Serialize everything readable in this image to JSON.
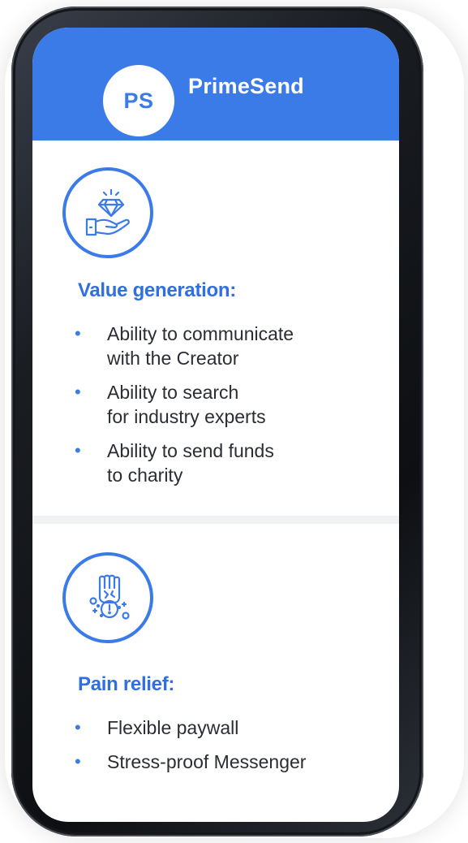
{
  "brand": {
    "initials": "PS",
    "name": "PrimeSend"
  },
  "colors": {
    "accent": "#3b7be8",
    "text": "#2a2d34"
  },
  "sections": [
    {
      "icon": "diamond-in-hand-icon",
      "title": "Value generation:",
      "items": [
        [
          "Ability to communicate",
          "with the Creator"
        ],
        [
          "Ability to search",
          "for industry experts"
        ],
        [
          "Ability to send funds",
          "to charity"
        ]
      ]
    },
    {
      "icon": "fist-with-badge-icon",
      "title": "Pain relief:",
      "items": [
        [
          "Flexible paywall"
        ],
        [
          "Stress-proof Messenger"
        ]
      ]
    }
  ],
  "bullet_glyph": "•"
}
